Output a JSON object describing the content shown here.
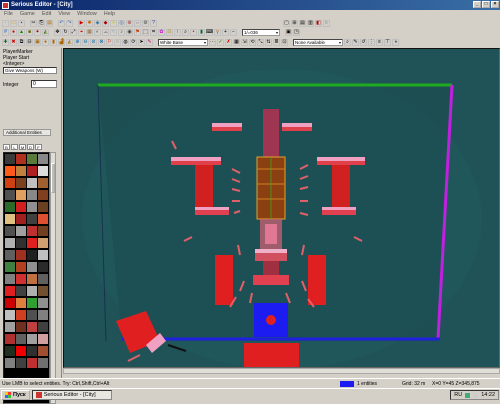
{
  "window": {
    "title": "Serious Editor - [City]"
  },
  "menu": [
    "File",
    "Game",
    "Edit",
    "View",
    "Window",
    "Help"
  ],
  "toolbar3": {
    "zoom_value": "1/=036"
  },
  "toolbar4": {
    "texture_combo": "White Base",
    "filter_combo": "None Available"
  },
  "left_panel": {
    "line1": "PlayerMarker",
    "line2": "Player Start",
    "line3": "<Integer>",
    "select_value": "Give Weapons (W)",
    "integer_label": "Integer",
    "integer_value": "0",
    "tab_label": "Additional Entities",
    "filters": [
      "B",
      "L",
      "M",
      "D",
      "F"
    ]
  },
  "palette": {
    "colors": [
      "#3a3a3a",
      "#b03020",
      "#5a7a3a",
      "#888888",
      "#ff5a1a",
      "#c08040",
      "#b02020",
      "#ddd",
      "#d04010",
      "#7a4020",
      "#c0c0c0",
      "#a06030",
      "#505050",
      "#e0a060",
      "#888",
      "#804020",
      "#2a6a2a",
      "#d02020",
      "#909090",
      "#6a4020",
      "#e0c080",
      "#a02020",
      "#404040",
      "#dd5030",
      "#505050",
      "#a0a0a0",
      "#c03030",
      "#704020",
      "#b0b0b0",
      "#303030",
      "#e02020",
      "#d0a070",
      "#606060",
      "#a03020",
      "#202020",
      "#c0c0c0",
      "#408040",
      "#b04020",
      "#909090",
      "#2a2a2a",
      "#808080",
      "#d03030",
      "#c07040",
      "#606060",
      "#e02020",
      "#404040",
      "#b0b0b0",
      "#705030",
      "#c00",
      "#e08040",
      "#30a030",
      "#909090",
      "#c0c0c0",
      "#d04020",
      "#505050",
      "#808080",
      "#a0a0a0",
      "#703020",
      "#c04040",
      "#404040",
      "#b03030",
      "#606060",
      "#a0a0a0",
      "#d0a0a0",
      "#203020",
      "#e00",
      "#303030",
      "#a05030",
      "#808080",
      "#404040",
      "#c03030",
      "#707070"
    ]
  },
  "viewport": {
    "background": "#1f5357",
    "border_green": "#1faa1f",
    "border_magenta": "#c020e0",
    "border_blue": "#2020e0"
  },
  "statusbar": {
    "hint": "Use LMB to select entities. Try: Ctrl,Shift,Ctrl+Alt",
    "selection_color": "#1c1cf0",
    "entities": "1 entities",
    "grid": "Grid: 32 m",
    "coords": "X=0 Y=45 Z=345,875"
  },
  "taskbar": {
    "start": "Пуск",
    "task": "Serious Editor - [City]",
    "lang": "RU",
    "clock": "14:22"
  }
}
